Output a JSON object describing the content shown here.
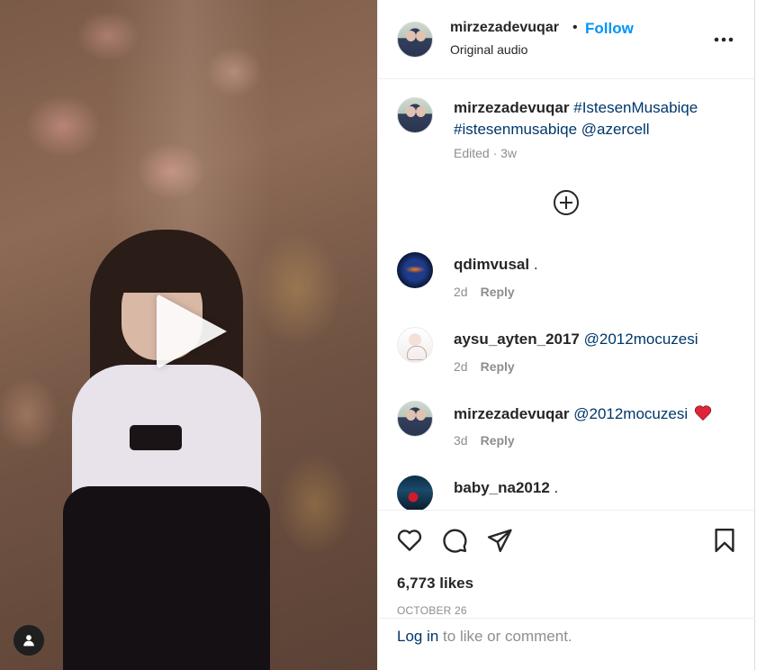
{
  "header": {
    "username": "mirzezadevuqar",
    "separator": "•",
    "follow_label": "Follow",
    "audio_label": "Original audio",
    "more_icon": "more-horizontal-icon"
  },
  "caption": {
    "username": "mirzezadevuqar",
    "text": "#IstesenMusabiqe #istesenmusabiqe @azercell",
    "meta": "Edited · 3w",
    "load_more_icon": "plus-circle-icon"
  },
  "comments": [
    {
      "username": "qdimvusal",
      "text": ".",
      "mention": "",
      "emoji": "",
      "age": "2d",
      "reply_label": "Reply"
    },
    {
      "username": "aysu_ayten_2017",
      "text": "",
      "mention": "@2012mocuzesi",
      "emoji": "",
      "age": "2d",
      "reply_label": "Reply"
    },
    {
      "username": "mirzezadevuqar",
      "text": "",
      "mention": "@2012mocuzesi",
      "emoji": "red-heart",
      "age": "3d",
      "reply_label": "Reply"
    },
    {
      "username": "baby_na2012",
      "text": ".",
      "mention": "",
      "emoji": "",
      "age": "",
      "reply_label": ""
    }
  ],
  "actions": {
    "icons": [
      "heart-icon",
      "comment-icon",
      "share-icon",
      "bookmark-icon"
    ],
    "likes": "6,773 likes",
    "date": "OCTOBER 26"
  },
  "login": {
    "link_label": "Log in",
    "rest": " to like or comment."
  },
  "colors": {
    "accent": "#0095f6",
    "link": "#00376b",
    "muted": "#8e8e8e",
    "text": "#262626",
    "heart": "#e0243a"
  }
}
